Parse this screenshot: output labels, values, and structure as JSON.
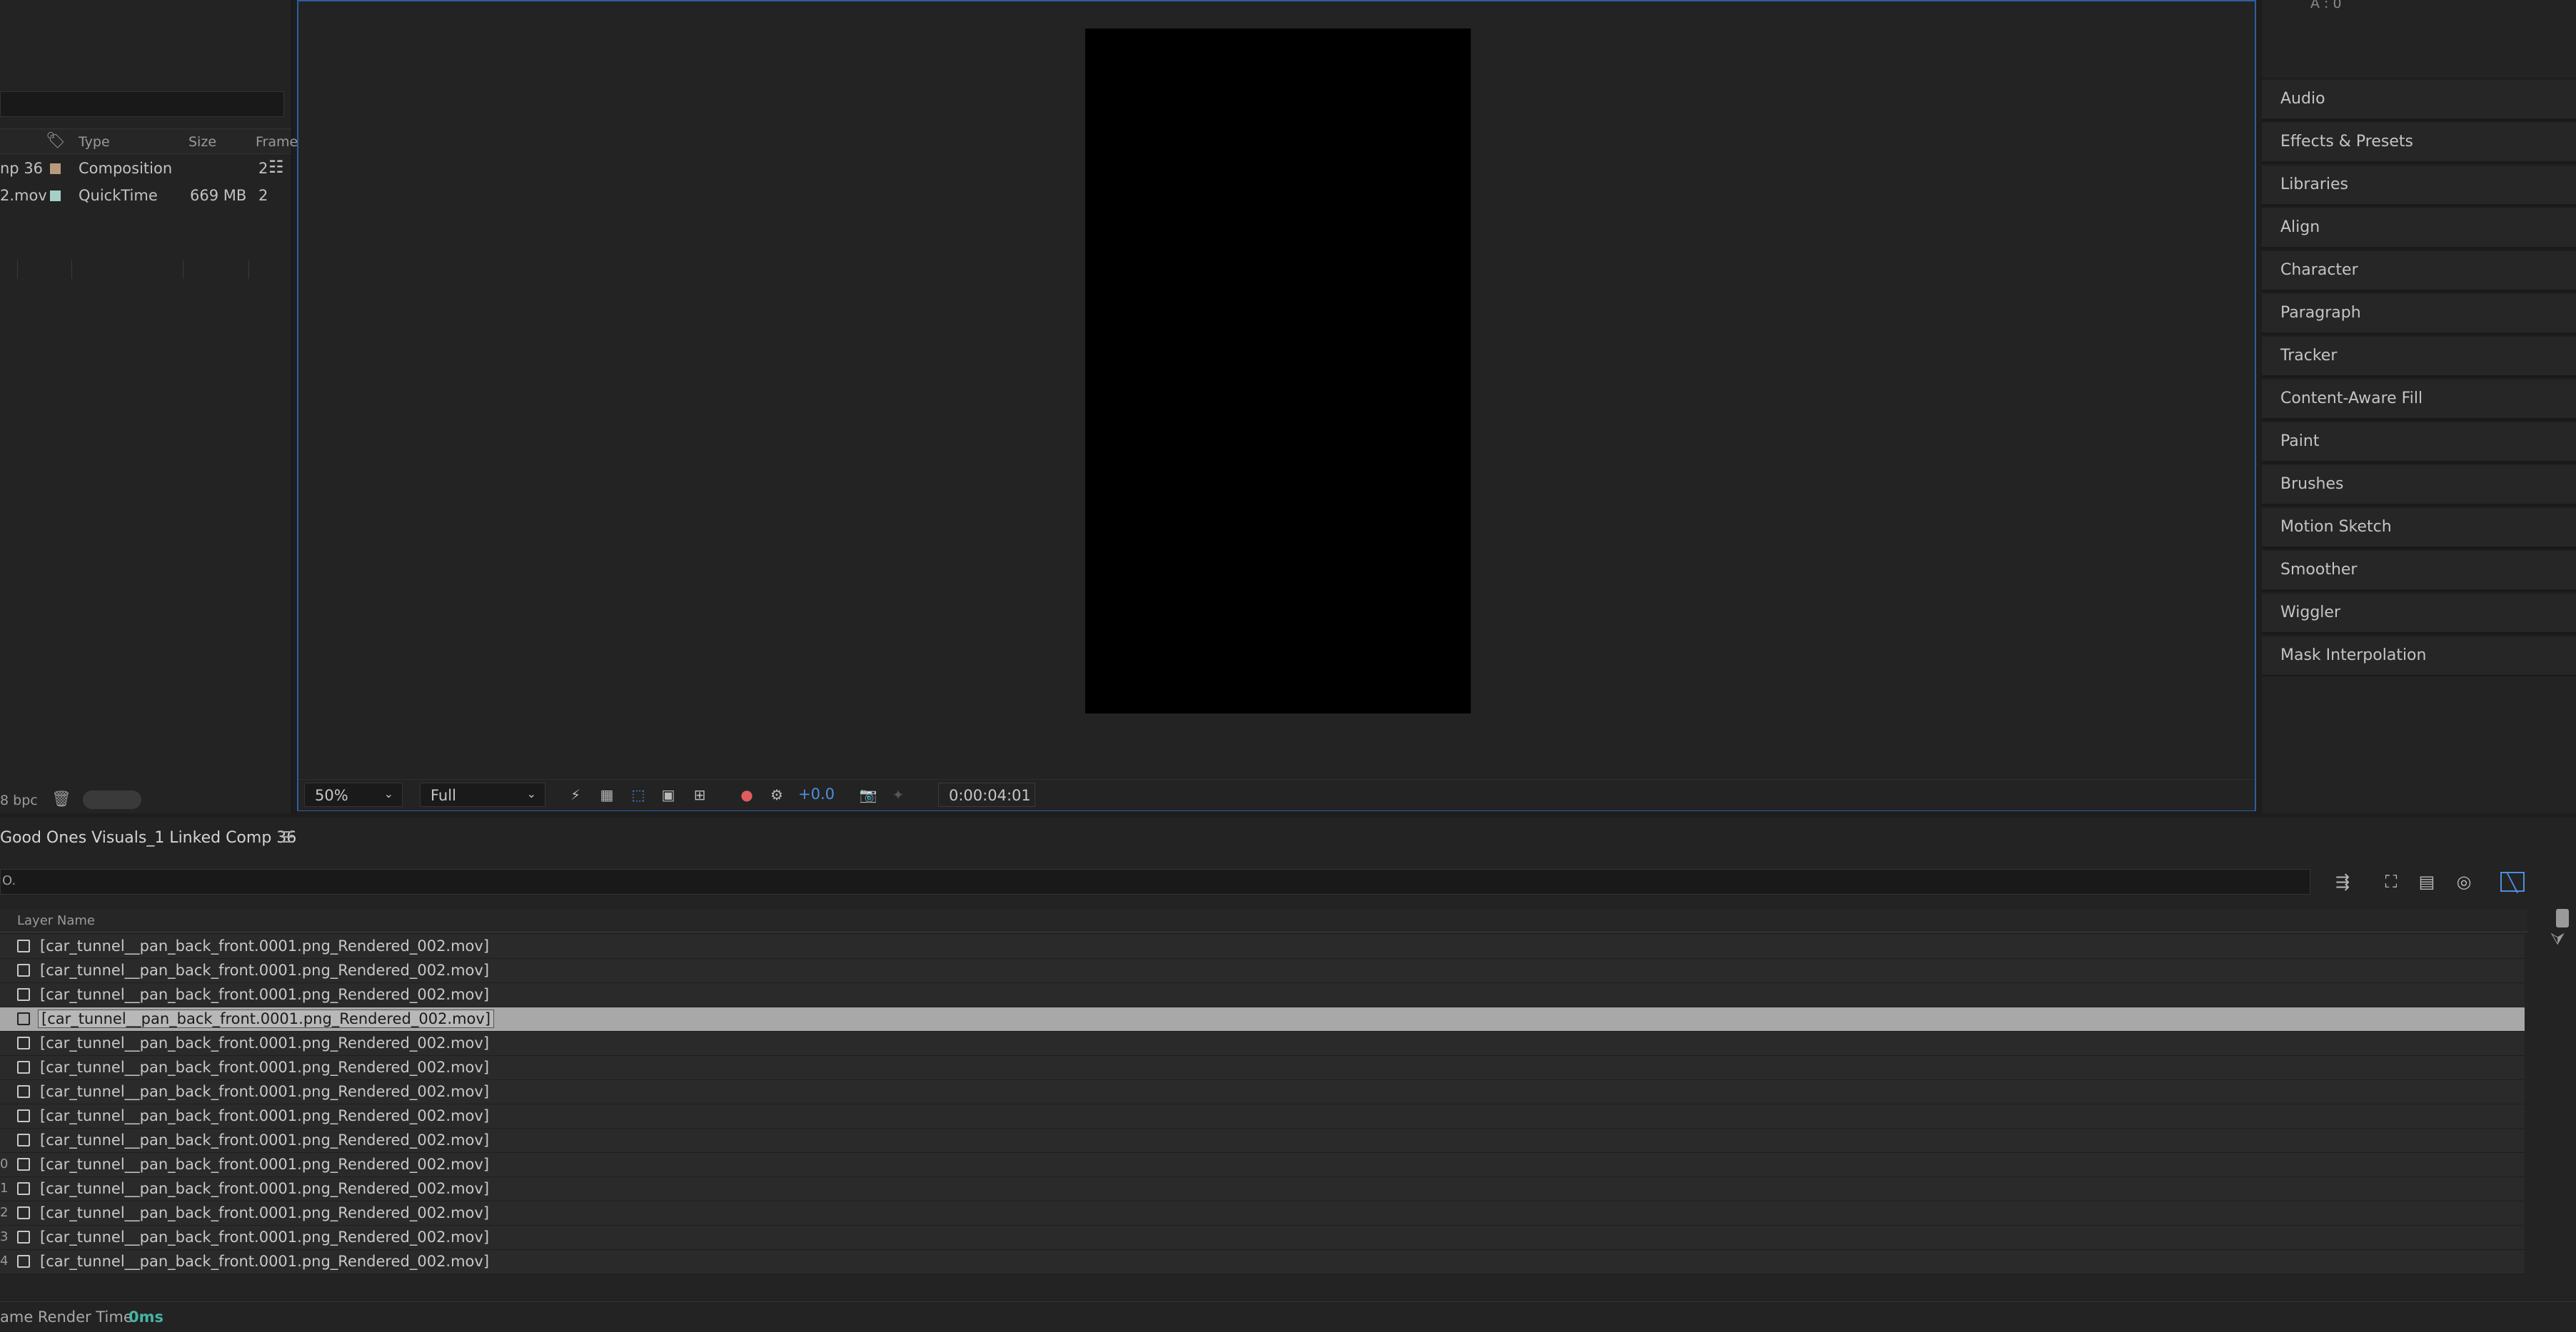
{
  "project": {
    "columns": [
      "Type",
      "Size",
      "Frame"
    ],
    "items": [
      {
        "name": "np 36",
        "type": "Composition",
        "size": "",
        "frame": "2",
        "label_color": "#b99a7a"
      },
      {
        "name": "2.mov",
        "type": "QuickTime",
        "size": "669 MB",
        "frame": "2",
        "label_color": "#a6d0c7"
      }
    ],
    "bit_depth": "8 bpc"
  },
  "viewer": {
    "zoom": "50%",
    "resolution": "Full",
    "exposure": "+0.0",
    "timecode": "0:00:04:01",
    "canvas_color": "#000000"
  },
  "info_panel": {
    "readout": "A :  0"
  },
  "panels": [
    "Audio",
    "Effects & Presets",
    "Libraries",
    "Align",
    "Character",
    "Paragraph",
    "Tracker",
    "Content-Aware Fill",
    "Paint",
    "Brushes",
    "Motion Sketch",
    "Smoother",
    "Wiggler",
    "Mask Interpolation"
  ],
  "timeline": {
    "comp_name": "Good Ones Visuals_1 Linked Comp 36",
    "search_prefix": "O.",
    "column_header": "Layer Name",
    "layers": [
      {
        "num": "",
        "name": "[car_tunnel__pan_back_front.0001.png_Rendered_002.mov]"
      },
      {
        "num": "",
        "name": "[car_tunnel__pan_back_front.0001.png_Rendered_002.mov]"
      },
      {
        "num": "",
        "name": "[car_tunnel__pan_back_front.0001.png_Rendered_002.mov]"
      },
      {
        "num": "",
        "name": "[car_tunnel__pan_back_front.0001.png_Rendered_002.mov]"
      },
      {
        "num": "",
        "name": "[car_tunnel__pan_back_front.0001.png_Rendered_002.mov]"
      },
      {
        "num": "",
        "name": "[car_tunnel__pan_back_front.0001.png_Rendered_002.mov]"
      },
      {
        "num": "",
        "name": "[car_tunnel__pan_back_front.0001.png_Rendered_002.mov]"
      },
      {
        "num": "",
        "name": "[car_tunnel__pan_back_front.0001.png_Rendered_002.mov]"
      },
      {
        "num": "",
        "name": "[car_tunnel__pan_back_front.0001.png_Rendered_002.mov]"
      },
      {
        "num": "0",
        "name": "[car_tunnel__pan_back_front.0001.png_Rendered_002.mov]"
      },
      {
        "num": "1",
        "name": "[car_tunnel__pan_back_front.0001.png_Rendered_002.mov]"
      },
      {
        "num": "2",
        "name": "[car_tunnel__pan_back_front.0001.png_Rendered_002.mov]"
      },
      {
        "num": "3",
        "name": "[car_tunnel__pan_back_front.0001.png_Rendered_002.mov]"
      },
      {
        "num": "4",
        "name": "[car_tunnel__pan_back_front.0001.png_Rendered_002.mov]"
      }
    ],
    "selected_index": 3,
    "status_label": "ame Render Time",
    "status_value": "0ms",
    "accent_color": "#46b3a4"
  },
  "icons": {
    "label_tag": "tag-icon",
    "flowchart": "flowchart-icon",
    "trash": "trash-icon",
    "file": "footage-file-icon"
  }
}
